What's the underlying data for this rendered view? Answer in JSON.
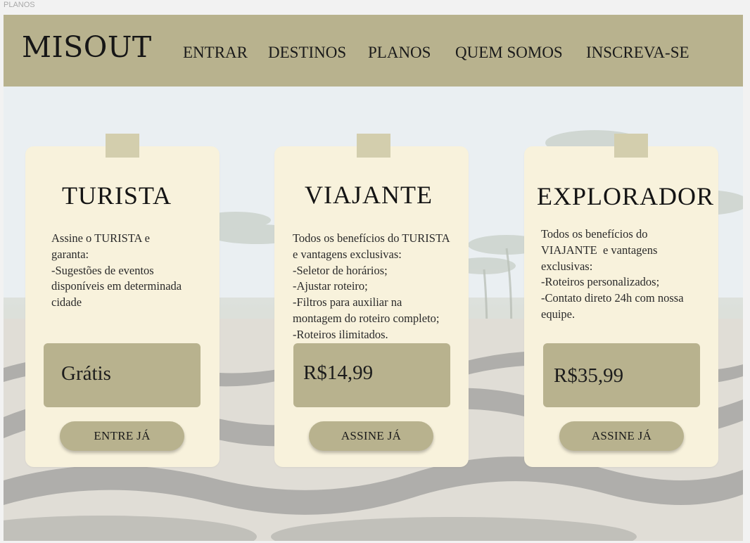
{
  "frame_label": "PLANOS",
  "header": {
    "logo": "MISOUT",
    "nav": [
      "ENTRAR",
      "DESTINOS",
      "PLANOS",
      "QUEM SOMOS",
      "INSCREVA-SE"
    ]
  },
  "plans": [
    {
      "title": "TURISTA",
      "description": [
        "Assine o TURISTA e",
        "garanta:",
        "-Sugestões de eventos",
        "disponíveis em determinada",
        "cidade"
      ],
      "price": "Grátis",
      "cta": "ENTRE JÁ"
    },
    {
      "title": "VIAJANTE",
      "description": [
        "Todos os benefícios do TURISTA",
        "e vantagens exclusivas:",
        "-Seletor de horários;",
        "-Ajustar roteiro;",
        "-Filtros para auxiliar na",
        "montagem do roteiro completo;",
        "-Roteiros ilimitados."
      ],
      "price": "R$14,99",
      "cta": "ASSINE JÁ"
    },
    {
      "title": "EXPLORADOR",
      "description": [
        "Todos os benefícios do",
        "VIAJANTE  e vantagens",
        "exclusivas:",
        "-Roteiros personalizados;",
        "-Contato direto 24h com nossa",
        "equipe."
      ],
      "price": "R$35,99",
      "cta": "ASSINE JÁ"
    }
  ],
  "colors": {
    "nav_bg": "#b8b28e",
    "card_bg": "#f8f2dc",
    "tab": "#d3cead",
    "text": "#1a1a1a"
  }
}
